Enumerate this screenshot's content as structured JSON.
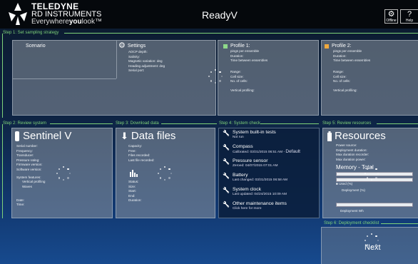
{
  "header": {
    "logo_line1": "TELEDYNE",
    "logo_line2": "RD INSTRUMENTS",
    "logo_line3a": "Everywhere",
    "logo_line3b": "you",
    "logo_line3c": "look",
    "app_title": "ReadyV",
    "offline_label": "Offline",
    "help_label": "Help"
  },
  "step1": {
    "label": "Step 1: Set sampling strategy",
    "scenario_label": "Scenario",
    "settings": {
      "title": "Settings",
      "fields": [
        "ADCP depth:",
        "Salinity:",
        "Magnetic variation:  deg",
        "Heading adjustment:  deg",
        "Serial port:"
      ]
    },
    "profile1": {
      "title": "Profile 1:",
      "color": "#8fd98a",
      "lines_a": [
        "pings per ensemble",
        "Duration:",
        "Time between ensembles"
      ],
      "lines_b": [
        "Range:",
        "Cell size:",
        "No. of cells:"
      ],
      "vertical": "Vertical profiling:"
    },
    "profile2": {
      "title": "Profile 2:",
      "color": "#f0a93e",
      "lines_a": [
        "pings per ensemble",
        "Duration:",
        "Time between ensembles"
      ],
      "lines_b": [
        "Range:",
        "Cell size:",
        "No. of cells:"
      ],
      "vertical": "Vertical profiling:"
    }
  },
  "step2": {
    "label": "Step 2: Review system",
    "title": "Sentinel V",
    "fields": [
      "Serial number:",
      "Frequency:",
      "Transducer:",
      "Pressure rating:",
      "Firmware version:",
      "Software version:"
    ],
    "features_label": "System features:",
    "features": [
      "Vertical profiling",
      "Waves"
    ],
    "date_label": "Date:",
    "time_label": "Time:"
  },
  "step3": {
    "label": "Step 3: Download data",
    "title": "Data files",
    "fields": [
      "Capacity:",
      "Free:",
      "Files recorded:",
      "Last file recorded:"
    ],
    "status_fields": [
      "Status:",
      "Size:",
      "Start:",
      "End:",
      "Duration:"
    ]
  },
  "step4": {
    "label": "Step 4: System check",
    "items": [
      {
        "title": "System built-in tests",
        "sub": "Not run"
      },
      {
        "title": "Compass",
        "sub": "Calibrated: 03/31/2015 06:51 AM",
        "extra": "Default"
      },
      {
        "title": "Pressure sensor",
        "sub": "Zeroed: 04/07/2015 07:01 AM"
      },
      {
        "title": "Battery",
        "sub": "Last changed: 03/31/2015 06:58 AM"
      },
      {
        "title": "System clock",
        "sub": "Last updated: 04/24/2015 10:09 AM"
      },
      {
        "title": "Other maintenance items",
        "sub": "Click here for more"
      }
    ]
  },
  "step5": {
    "label": "Step 5: Review resources",
    "title": "Resources",
    "fields": [
      "Power source:",
      "Deployment duration:",
      "Max duration recorder:",
      "Max duration power:"
    ],
    "memory_label": "Memory - Total",
    "used_label": "Used  (%)",
    "deployment_pct_label": "Deployment  (%)",
    "deployment_wh_label": "Deployment  Wh"
  },
  "step6": {
    "label": "Step 6: Deployment checklist",
    "next_label": "Next"
  }
}
